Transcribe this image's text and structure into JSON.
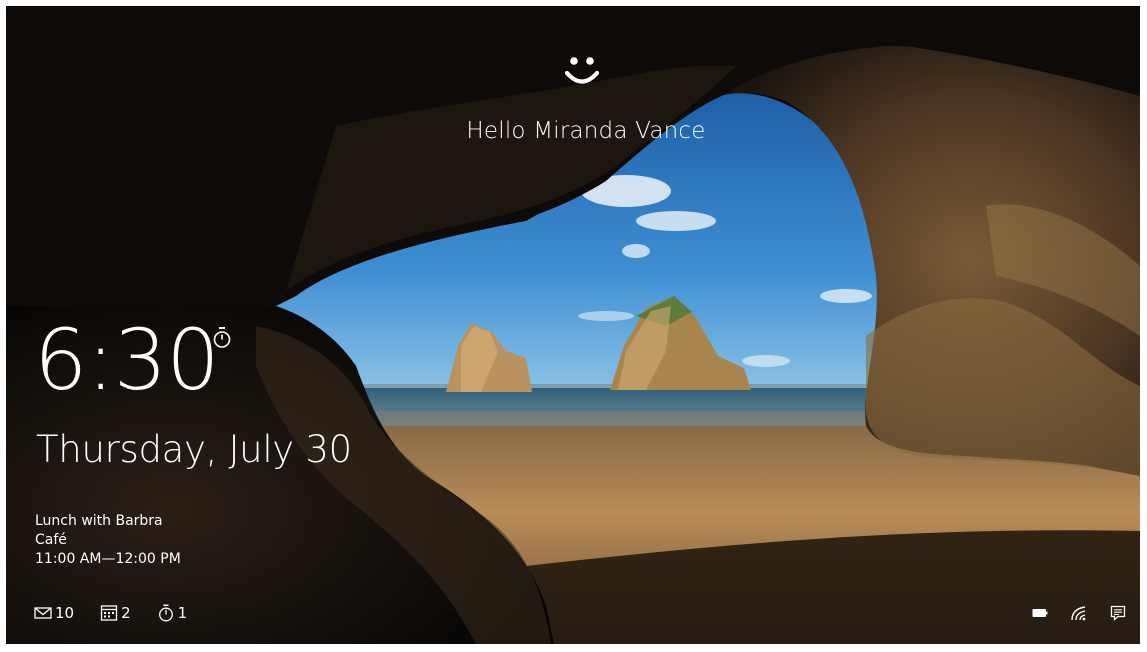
{
  "lockscreen": {
    "greeting": "Hello Miranda Vance",
    "time": "6:30",
    "date": "Thursday, July 30",
    "event": {
      "title": "Lunch with Barbra",
      "location": "Café",
      "time_range": "11:00 AM—12:00 PM"
    },
    "badges": [
      {
        "app": "mail",
        "icon": "envelope-icon",
        "count": "10"
      },
      {
        "app": "calendar",
        "icon": "calendar-icon",
        "count": "2"
      },
      {
        "app": "alarms",
        "icon": "stopwatch-icon",
        "count": "1"
      }
    ],
    "tray": [
      {
        "icon": "battery-icon"
      },
      {
        "icon": "wifi-icon"
      },
      {
        "icon": "notification-icon"
      }
    ]
  },
  "colors": {
    "text": "#ffffff",
    "sky": "#2f7fc8",
    "sand": "#b88c57",
    "rock": "#2a1f16"
  }
}
